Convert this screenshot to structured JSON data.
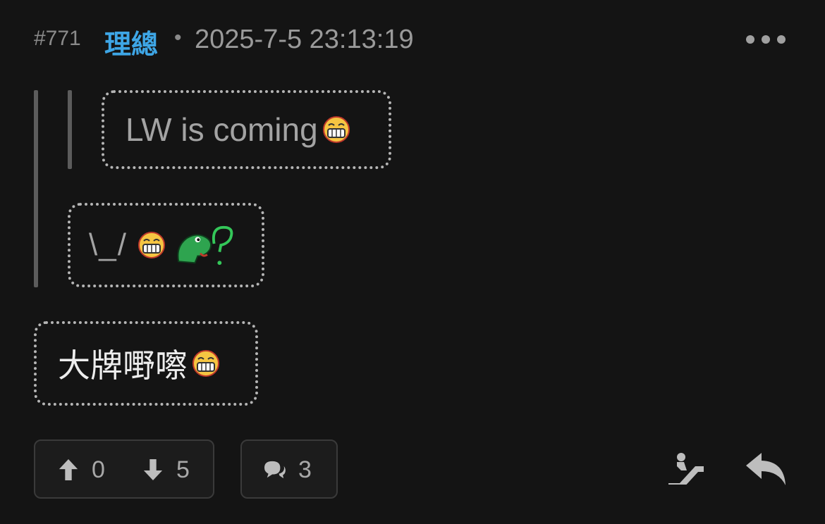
{
  "post": {
    "number": "#771",
    "author": "理總",
    "separator": "•",
    "timestamp": "2025-7-5 23:13:19"
  },
  "quotes": {
    "nested_quote_text": "LW is coming",
    "quote_text": "\\_/"
  },
  "reply": {
    "text": "大牌嘢嚓"
  },
  "actions": {
    "upvotes": "0",
    "downvotes": "5",
    "comments": "3"
  },
  "icons": {
    "more": "more-horizontal-icon",
    "grin_emoji": "grinning-face-emoji",
    "dino_emoji": "green-dinosaur-question-emoji",
    "upvote": "arrow-up-icon",
    "downvote": "arrow-down-icon",
    "comment": "comments-icon",
    "escalator": "escalator-icon",
    "reply": "reply-icon"
  },
  "colors": {
    "background": "#141414",
    "author": "#3ea6e6",
    "meta": "#8a8a8a"
  }
}
